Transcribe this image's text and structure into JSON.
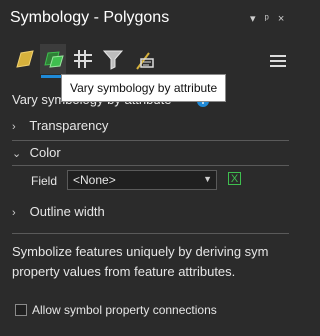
{
  "pane": {
    "title": "Symbology - Polygons",
    "controls": [
      "▾",
      "ᵖ",
      "×"
    ]
  },
  "tools": [
    {
      "icon": "primary-symbology-icon"
    },
    {
      "icon": "vary-symbology-icon"
    },
    {
      "icon": "symbol-layer-drawing-icon"
    },
    {
      "icon": "filter-icon"
    },
    {
      "icon": "label-class-icon"
    }
  ],
  "tooltip": "Vary symbology by attribute",
  "section_title": "Vary symbology by attribute",
  "groups": {
    "transparency": "Transparency",
    "color": "Color",
    "outline_width": "Outline width"
  },
  "color": {
    "field_label": "Field",
    "field_value": "<None>"
  },
  "description": {
    "line1": "Symbolize features uniquely by deriving sym",
    "line2": "property values from feature attributes."
  },
  "checkbox_label": "Allow symbol property connections",
  "colors": {
    "background": "#2b2b2b",
    "accent": "#1f8ad8",
    "green": "#3fbf4f"
  }
}
